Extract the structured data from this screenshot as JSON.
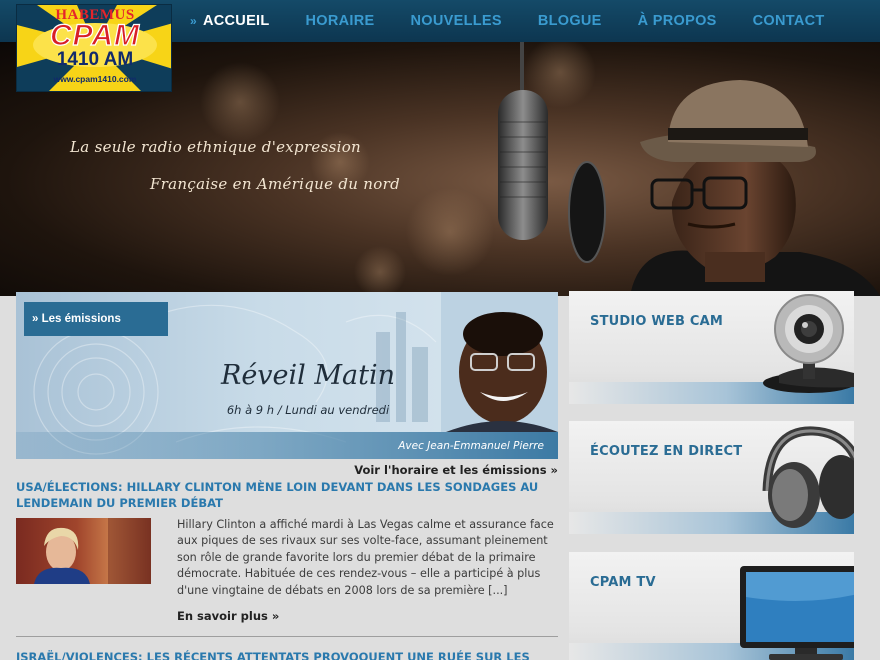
{
  "site": {
    "logo": {
      "top": "HABEMUS",
      "main": "CPAM",
      "frequency": "1410 AM",
      "url": "www.cpam1410.com"
    }
  },
  "nav": {
    "items": [
      {
        "label": "ACCUEIL",
        "active": true
      },
      {
        "label": "HORAIRE"
      },
      {
        "label": "NOUVELLES"
      },
      {
        "label": "BLOGUE"
      },
      {
        "label": "À PROPOS"
      },
      {
        "label": "CONTACT"
      }
    ],
    "active_marker": "»"
  },
  "hero": {
    "tagline_line1": "La seule radio ethnique d'expression",
    "tagline_line2": "Française en Amérique du nord"
  },
  "feature": {
    "tab_label": "» Les émissions",
    "show_title": "Réveil Matin",
    "show_hours": "6h à 9 h / Lundi au vendredi",
    "host": "Avec Jean-Emmanuel Pierre",
    "link": "Voir l'horaire et les émissions »"
  },
  "articles": [
    {
      "headline": "USA/ÉLECTIONS: HILLARY CLINTON MÈNE LOIN DEVANT DANS LES SONDAGES AU LENDEMAIN DU PREMIER DÉBAT",
      "excerpt": "Hillary Clinton a affiché mardi à Las Vegas calme et assurance face aux piques de ses rivaux sur ses volte-face, assumant pleinement son rôle de grande favorite lors du premier débat de la primaire démocrate. Habituée de ces rendez-vous – elle a participé à plus d'une vingtaine de débats en 2008 lors de sa première [...]",
      "more": "En savoir plus »"
    },
    {
      "headline": "ISRAËL/VIOLENCES: LES RÉCENTS ATTENTATS PROVOQUENT UNE RUÉE SUR LES ARMES À FEU"
    }
  ],
  "sidebar": {
    "widgets": [
      {
        "label": "STUDIO WEB CAM",
        "icon": "webcam-icon"
      },
      {
        "label": "ÉCOUTEZ EN DIRECT",
        "icon": "headphones-icon"
      },
      {
        "label": "CPAM TV",
        "icon": "tv-icon"
      }
    ]
  },
  "colors": {
    "nav_bg": "#0d3650",
    "nav_link": "#3a9bd0",
    "headline": "#2a79ad",
    "accent": "#2a6c94"
  }
}
